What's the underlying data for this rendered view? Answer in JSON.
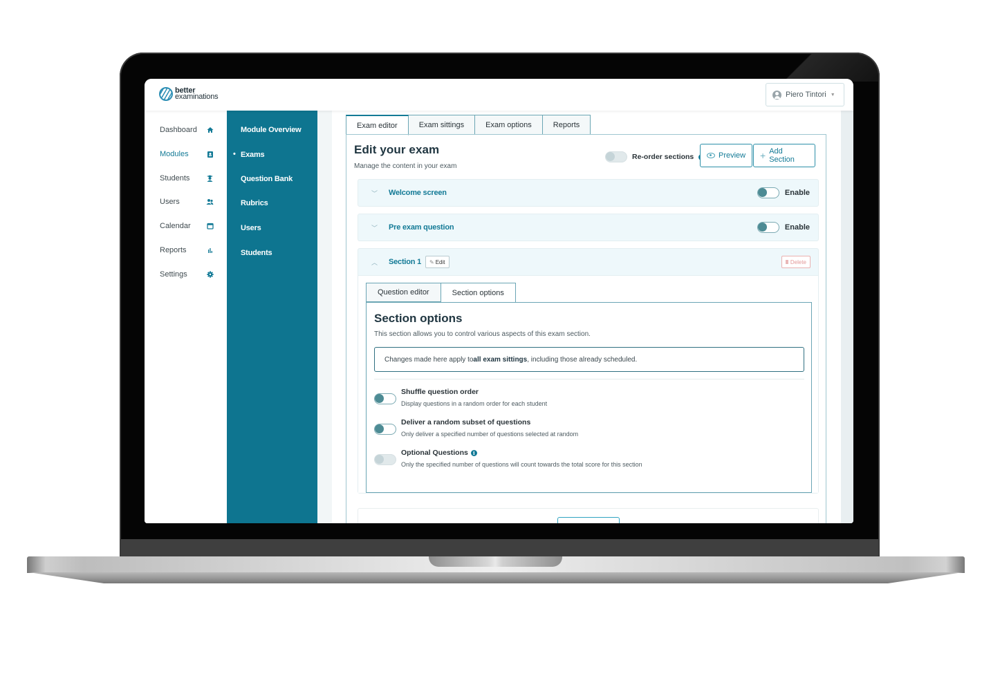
{
  "app": {
    "logo": {
      "line1": "better",
      "line2": "examinations"
    },
    "user": {
      "name": "Piero Tintori",
      "icon": "user-circle-icon"
    }
  },
  "main_nav": [
    {
      "label": "Dashboard",
      "icon": "home-icon",
      "active": false
    },
    {
      "label": "Modules",
      "icon": "clipboard-user-icon",
      "active": true
    },
    {
      "label": "Students",
      "icon": "graduate-icon",
      "active": false
    },
    {
      "label": "Users",
      "icon": "users-icon",
      "active": false
    },
    {
      "label": "Calendar",
      "icon": "calendar-icon",
      "active": false
    },
    {
      "label": "Reports",
      "icon": "bar-chart-icon",
      "active": false
    },
    {
      "label": "Settings",
      "icon": "gear-icon",
      "active": false
    }
  ],
  "sub_nav": [
    {
      "label": "Module Overview",
      "active": false
    },
    {
      "label": "Exams",
      "active": true
    },
    {
      "label": "Question Bank",
      "active": false
    },
    {
      "label": "Rubrics",
      "active": false
    },
    {
      "label": "Users",
      "active": false
    },
    {
      "label": "Students",
      "active": false
    }
  ],
  "tabs": [
    {
      "label": "Exam editor",
      "active": true
    },
    {
      "label": "Exam sittings",
      "active": false
    },
    {
      "label": "Exam options",
      "active": false
    },
    {
      "label": "Reports",
      "active": false
    }
  ],
  "editor": {
    "title": "Edit your exam",
    "subtitle": "Manage the content in your exam",
    "reorder_label": "Re-order sections",
    "reorder_enabled": false,
    "preview_label": "Preview",
    "add_section_label": "Add Section",
    "add_icon": "+"
  },
  "accordions": [
    {
      "title": "Welcome screen",
      "toggle_label": "Enable",
      "enabled": false,
      "expanded": false
    },
    {
      "title": "Pre exam question",
      "toggle_label": "Enable",
      "enabled": false,
      "expanded": false
    },
    {
      "title": "Section 1",
      "edit_label": "Edit",
      "delete_label": "Delete",
      "expanded": true
    }
  ],
  "section": {
    "tabs": [
      {
        "label": "Question editor",
        "active": false
      },
      {
        "label": "Section options",
        "active": true
      }
    ],
    "options_title": "Section options",
    "options_desc": "This section allows you to control various aspects of this exam section.",
    "notice": {
      "prefix": "Changes made here apply to ",
      "bold": "all exam sittings",
      "suffix": ", including those already scheduled."
    },
    "options": [
      {
        "title": "Shuffle question order",
        "desc": "Display questions in a random order for each student",
        "enabled": false,
        "disabled": false,
        "info": false
      },
      {
        "title": "Deliver a random subset of questions",
        "desc": "Only deliver a specified number of questions selected at random",
        "enabled": false,
        "disabled": false,
        "info": false
      },
      {
        "title": "Optional Questions",
        "desc": "Only the specified number of questions will count towards the total score for this section",
        "enabled": false,
        "disabled": true,
        "info": true
      }
    ]
  },
  "colors": {
    "brand_teal": "#0e7590",
    "accent": "#137a96",
    "accordion_bg": "#eef8fb",
    "delete_red": "#e39999"
  }
}
